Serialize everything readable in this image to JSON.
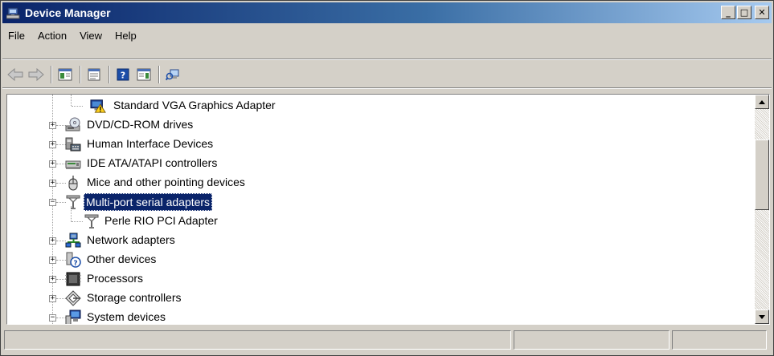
{
  "window": {
    "title": "Device Manager"
  },
  "title_buttons": {
    "minimize": "_",
    "maximize": "□",
    "close": "✕"
  },
  "menu": {
    "items": [
      "File",
      "Action",
      "View",
      "Help"
    ]
  },
  "toolbar": {
    "buttons": [
      "back-arrow-icon",
      "forward-arrow-icon",
      "show-hide-tree-icon",
      "properties-icon",
      "help-icon",
      "action-pane-icon",
      "scan-hardware-icon"
    ]
  },
  "tree": {
    "rows": [
      {
        "label": "Standard VGA Graphics Adapter",
        "icon": "display-warning-icon",
        "expander": ""
      },
      {
        "label": "DVD/CD-ROM drives",
        "icon": "dvd-drive-icon",
        "expander": "+"
      },
      {
        "label": "Human Interface Devices",
        "icon": "hid-icon",
        "expander": "+"
      },
      {
        "label": "IDE ATA/ATAPI controllers",
        "icon": "ide-controller-icon",
        "expander": "+"
      },
      {
        "label": "Mice and other pointing devices",
        "icon": "mouse-icon",
        "expander": "+"
      },
      {
        "label": "Multi-port serial adapters",
        "icon": "serial-adapter-icon",
        "expander": "−"
      },
      {
        "label": "Perle RIO PCI Adapter",
        "icon": "serial-adapter-icon",
        "expander": ""
      },
      {
        "label": "Network adapters",
        "icon": "network-icon",
        "expander": "+"
      },
      {
        "label": "Other devices",
        "icon": "unknown-device-icon",
        "expander": "+"
      },
      {
        "label": "Processors",
        "icon": "processor-icon",
        "expander": "+"
      },
      {
        "label": "Storage controllers",
        "icon": "storage-controller-icon",
        "expander": "+"
      },
      {
        "label": "System devices",
        "icon": "system-devices-icon",
        "expander": "−"
      }
    ],
    "selected": "Multi-port serial adapters"
  },
  "statusbar": {
    "panels": [
      "",
      "",
      ""
    ]
  },
  "colors": {
    "titlebar_start": "#0a246a",
    "titlebar_end": "#a6caf0",
    "selection": "#0a246a",
    "chrome": "#d4d0c8"
  }
}
